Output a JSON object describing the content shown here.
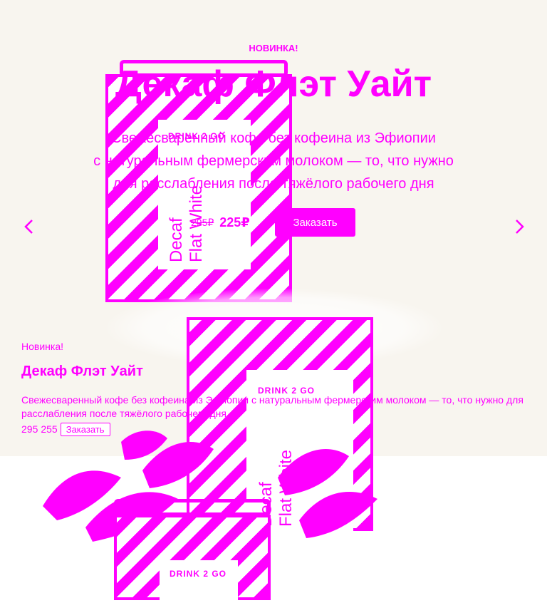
{
  "hero": {
    "badge": "НОВИНКА!",
    "title": "Декаф Флэт Уайт",
    "subtitle_lines": [
      "Свежесваренный кофе без кофеина из Эфиопии",
      "с натуральным фермерским молоком — то, что нужно",
      "для расслабления после тяжёлого рабочего дня"
    ],
    "old_price": "295₽",
    "new_price": "225₽",
    "order_label": "Заказать",
    "prev_icon": "chevron-left-icon",
    "next_icon": "chevron-right-icon"
  },
  "product_art": {
    "brand": "DRINK 2 GO",
    "name_line1": "Decaf",
    "name_line2": "Flat White"
  },
  "lower": {
    "badge": "Новинка!",
    "title": "Декаф Флэт Уайт",
    "description": "Свежесваренный кофе без кофеина из Эфиопии с натуральным фермерским молоком — то, что нужно для расслабления после тяжёлого рабочего дня",
    "old_price": "295",
    "new_price": "255",
    "order_label": "Заказать"
  },
  "colors": {
    "accent": "#ff00ff",
    "hero_background": "#f8f5ef",
    "page_background": "#ffffff"
  }
}
